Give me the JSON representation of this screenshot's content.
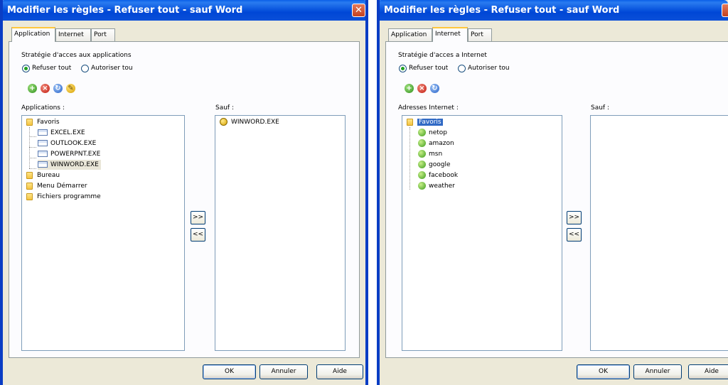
{
  "windows": [
    {
      "title": "Modifier les règles - Refuser tout - sauf Word",
      "close_glyph": "✕",
      "tabs": [
        "Application",
        "Internet",
        "Port"
      ],
      "active_tab": "Application",
      "strategy_label": "Stratégie d'acces aux applications",
      "radio_deny": "Refuser tout",
      "radio_allow": "Autoriser tou",
      "toolbar_icons": [
        "add-icon",
        "delete-icon",
        "refresh-icon",
        "edit-icon"
      ],
      "list_label": "Applications :",
      "tree": {
        "favorites": "Favoris",
        "favorite_items": [
          "EXCEL.EXE",
          "OUTLOOK.EXE",
          "POWERPNT.EXE",
          "WINWORD.EXE"
        ],
        "folders": [
          "Bureau",
          "Menu Démarrer",
          "Fichiers programme"
        ]
      },
      "except_label": "Sauf :",
      "except_items": [
        "WINWORD.EXE"
      ],
      "move_right": ">>",
      "move_left": "<<",
      "ok": "OK",
      "cancel": "Annuler",
      "help": "Aide"
    },
    {
      "title": "Modifier les règles - Refuser tout - sauf Word",
      "tabs": [
        "Application",
        "Internet",
        "Port"
      ],
      "active_tab": "Internet",
      "strategy_label": "Stratégie d'acces a Internet",
      "radio_deny": "Refuser tout",
      "radio_allow": "Autoriser tou",
      "toolbar_icons": [
        "add-icon",
        "delete-icon",
        "refresh-icon"
      ],
      "list_label": "Adresses Internet :",
      "tree": {
        "favorites": "Favoris",
        "favorite_items": [
          "netop",
          "amazon",
          "msn",
          "google",
          "facebook",
          "weather"
        ]
      },
      "except_label": "Sauf :",
      "move_right": ">>",
      "move_left": "<<",
      "ok": "OK",
      "cancel": "Annuler",
      "help": "Aide"
    }
  ],
  "colors": {
    "title_bar": "#0a5fe8",
    "dialog_bg": "#ece9d8",
    "active_tab_accent": "#ffc73c"
  }
}
